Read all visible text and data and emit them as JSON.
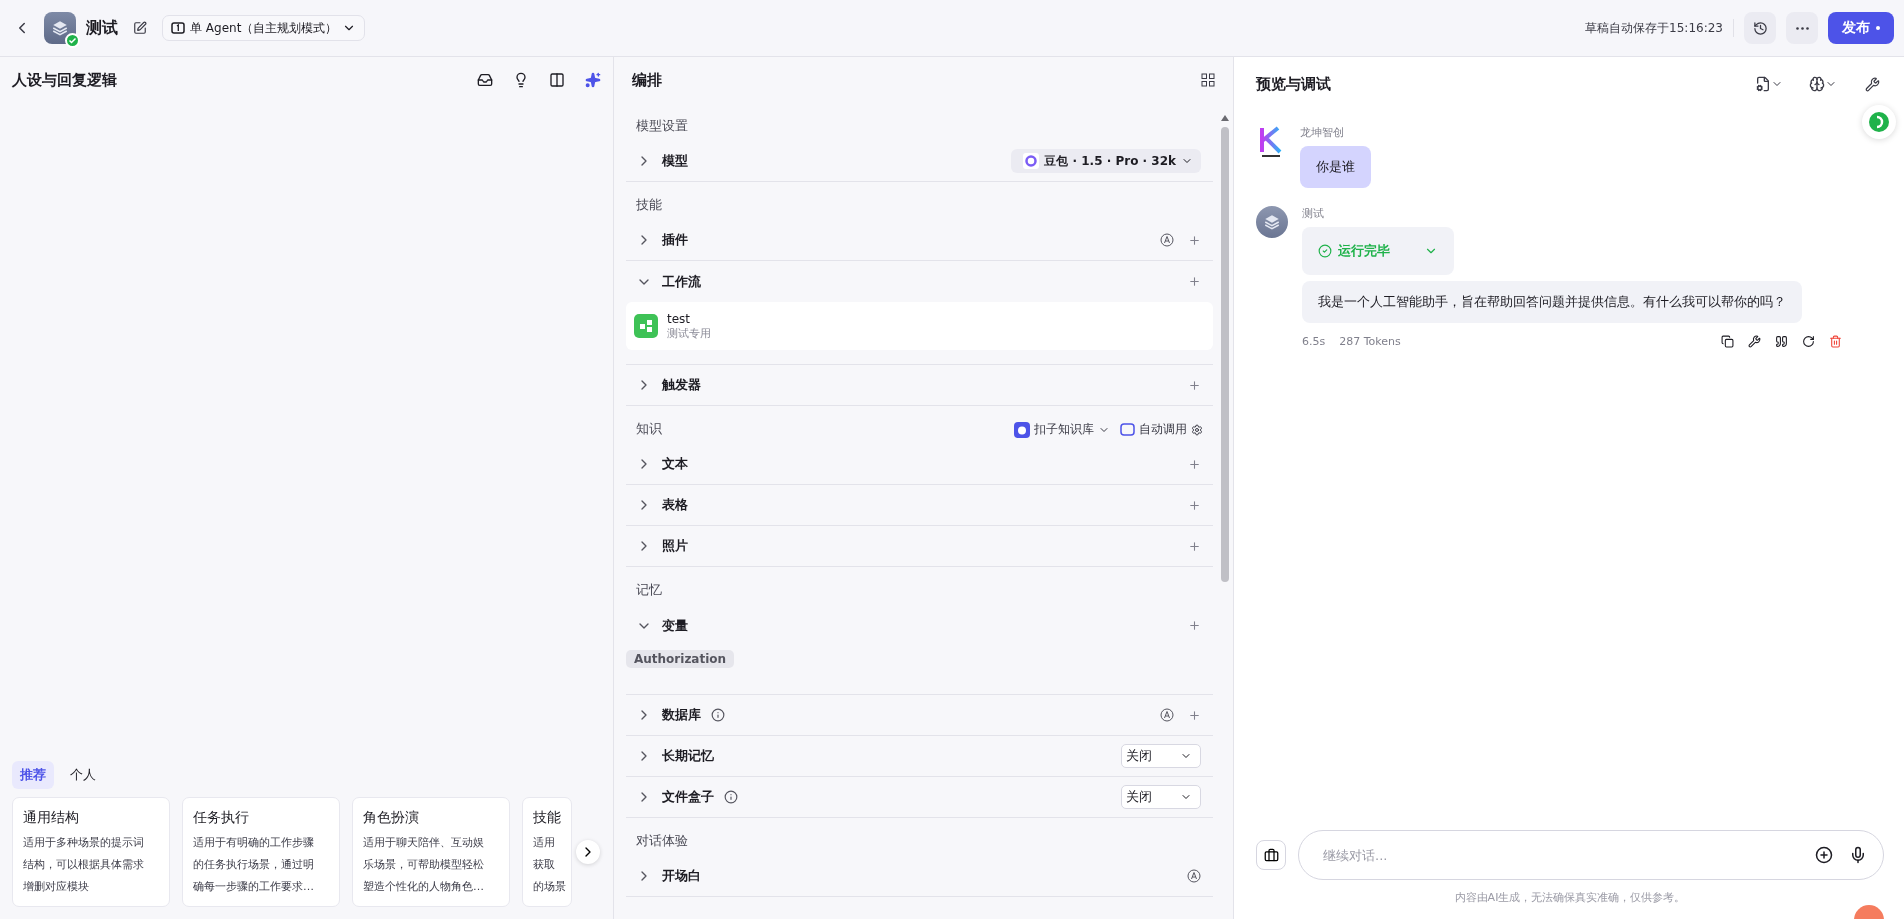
{
  "header": {
    "title": "测试",
    "mode": "单 Agent（自主规划模式）",
    "save_status": "草稿自动保存于15:16:23",
    "publish": "发布"
  },
  "persona": {
    "title": "人设与回复逻辑",
    "tabs": [
      {
        "label": "推荐",
        "selected": true
      },
      {
        "label": "个人",
        "selected": false
      }
    ],
    "templates": [
      {
        "title": "通用结构",
        "lines": [
          "适用于多种场景的提示词",
          "结构，可以根据具体需求",
          "增删对应模块"
        ]
      },
      {
        "title": "任务执行",
        "lines": [
          "适用于有明确的工作步骤",
          "的任务执行场景，通过明",
          "确每一步骤的工作要求…"
        ]
      },
      {
        "title": "角色扮演",
        "lines": [
          "适用于聊天陪伴、互动娱",
          "乐场景，可帮助模型轻松",
          "塑造个性化的人物角色…"
        ]
      },
      {
        "title": "技能",
        "lines": [
          "适用",
          "获取",
          "的场景"
        ]
      }
    ]
  },
  "arrange": {
    "title": "编排",
    "sections": [
      {
        "title": "模型设置",
        "rows": [
          {
            "label": "模型",
            "expanded": false,
            "kind": "model",
            "value": "豆包 · 1.5 · Pro · 32k"
          }
        ]
      },
      {
        "title": "技能",
        "rows": [
          {
            "label": "插件",
            "expanded": false,
            "kind": "add",
            "auto": true
          },
          {
            "label": "工作流",
            "expanded": true,
            "kind": "add",
            "items": [
              {
                "name": "test",
                "desc": "测试专用"
              }
            ]
          },
          {
            "label": "触发器",
            "expanded": false,
            "kind": "add"
          }
        ]
      },
      {
        "title": "知识",
        "library": "扣子知识库",
        "invoke": "自动调用",
        "rows": [
          {
            "label": "文本",
            "expanded": false,
            "kind": "add"
          },
          {
            "label": "表格",
            "expanded": false,
            "kind": "add"
          },
          {
            "label": "照片",
            "expanded": false,
            "kind": "add"
          }
        ]
      },
      {
        "title": "记忆",
        "rows": [
          {
            "label": "变量",
            "expanded": true,
            "kind": "add",
            "tags": [
              "Authorization"
            ]
          },
          {
            "label": "数据库",
            "expanded": false,
            "kind": "add",
            "info": true,
            "auto": true
          },
          {
            "label": "长期记忆",
            "expanded": false,
            "kind": "select",
            "value": "关闭"
          },
          {
            "label": "文件盒子",
            "expanded": false,
            "kind": "select",
            "info": true,
            "value": "关闭"
          }
        ]
      },
      {
        "title": "对话体验",
        "rows": [
          {
            "label": "开场白",
            "expanded": false,
            "kind": "none",
            "auto": true
          }
        ]
      }
    ]
  },
  "preview": {
    "title": "预览与调试",
    "messages": [
      {
        "kind": "user",
        "sender": "龙坤智创",
        "text": "你是谁"
      },
      {
        "kind": "bot",
        "sender": "测试",
        "status": "运行完毕",
        "text": "我是一个人工智能助手，旨在帮助回答问题并提供信息。有什么我可以帮你的吗？",
        "time": "6.5s",
        "tokens": "287 Tokens"
      }
    ],
    "input": {
      "placeholder": "继续对话..."
    },
    "disclaimer": "内容由AI生成，无法确保真实准确，仅供参考。"
  }
}
